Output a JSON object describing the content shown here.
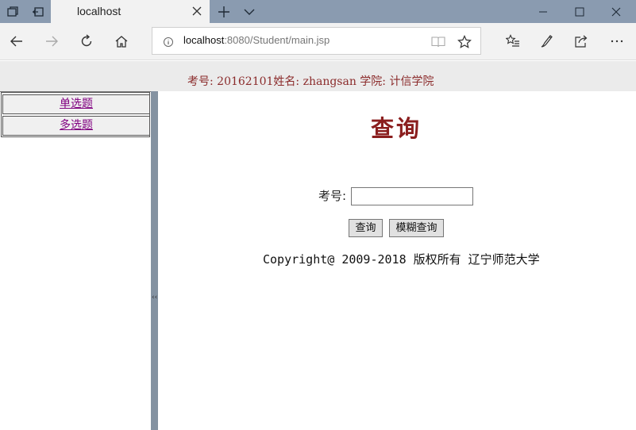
{
  "browser": {
    "tab_title": "localhost",
    "url_host": "localhost",
    "url_rest": ":8080/Student/main.jsp"
  },
  "header": {
    "student_info": "考号: 20162101姓名: zhangsan 学院: 计信学院"
  },
  "sidebar": {
    "items": [
      {
        "label": "单选题"
      },
      {
        "label": "多选题"
      }
    ]
  },
  "main": {
    "title": "查询",
    "id_label": "考号:",
    "id_input_value": "",
    "query_button": "查询",
    "fuzzy_query_button": "模糊查询",
    "copyright": "Copyright@ 2009-2018 版权所有 辽宁师范大学"
  },
  "colors": {
    "title_text": "#8b1e1e",
    "info_text": "#8b2b2b",
    "visited_link": "#800080",
    "titlebar": "#8a9bb0",
    "splitter": "#8492a1"
  },
  "icons": [
    "tab-list-icon",
    "set-aside-tabs-icon",
    "close-icon",
    "new-tab-icon",
    "tab-preview-icon",
    "minimize-icon",
    "maximize-icon",
    "back-icon",
    "forward-icon",
    "refresh-icon",
    "home-icon",
    "info-icon",
    "reading-view-icon",
    "favorite-star-icon",
    "favorites-list-icon",
    "pen-icon",
    "share-icon",
    "more-icon"
  ]
}
